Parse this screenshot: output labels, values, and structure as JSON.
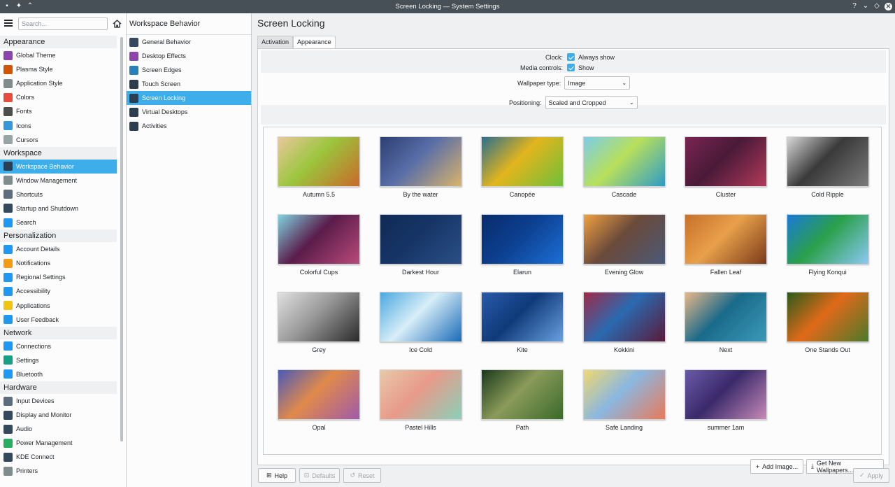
{
  "window": {
    "title": "Screen Locking — System Settings",
    "buttons": [
      "?",
      "⌄",
      "◇",
      "✕"
    ]
  },
  "sidebar": {
    "search_placeholder": "Search...",
    "groups": [
      {
        "title": "Appearance",
        "items": [
          {
            "label": "Global Theme",
            "icon": "global-theme-icon",
            "color": "#8e44ad"
          },
          {
            "label": "Plasma Style",
            "icon": "plasma-style-icon",
            "color": "#d35400"
          },
          {
            "label": "Application Style",
            "icon": "brush-icon",
            "color": "#7f8c8d"
          },
          {
            "label": "Colors",
            "icon": "colors-icon",
            "color": "#e74c3c"
          },
          {
            "label": "Fonts",
            "icon": "fonts-icon",
            "color": "#4d4d4d"
          },
          {
            "label": "Icons",
            "icon": "icons-icon",
            "color": "#3498db"
          },
          {
            "label": "Cursors",
            "icon": "cursor-icon",
            "color": "#95a5a6"
          }
        ]
      },
      {
        "title": "Workspace",
        "items": [
          {
            "label": "Workspace Behavior",
            "icon": "workspace-icon",
            "color": "#2c3e50",
            "selected": true
          },
          {
            "label": "Window Management",
            "icon": "window-icon",
            "color": "#7f8c8d"
          },
          {
            "label": "Shortcuts",
            "icon": "keyboard-icon",
            "color": "#5d6d7e"
          },
          {
            "label": "Startup and Shutdown",
            "icon": "startup-icon",
            "color": "#34495e"
          },
          {
            "label": "Search",
            "icon": "search-icon",
            "color": "#1d99f3"
          }
        ]
      },
      {
        "title": "Personalization",
        "items": [
          {
            "label": "Account Details",
            "icon": "account-icon",
            "color": "#1d99f3"
          },
          {
            "label": "Notifications",
            "icon": "bell-icon",
            "color": "#f39c12"
          },
          {
            "label": "Regional Settings",
            "icon": "flag-icon",
            "color": "#1d99f3"
          },
          {
            "label": "Accessibility",
            "icon": "accessibility-icon",
            "color": "#1d99f3"
          },
          {
            "label": "Applications",
            "icon": "star-icon",
            "color": "#f1c40f"
          },
          {
            "label": "User Feedback",
            "icon": "feedback-icon",
            "color": "#1d99f3"
          }
        ]
      },
      {
        "title": "Network",
        "items": [
          {
            "label": "Connections",
            "icon": "connections-icon",
            "color": "#1d99f3"
          },
          {
            "label": "Settings",
            "icon": "globe-icon",
            "color": "#16a085"
          },
          {
            "label": "Bluetooth",
            "icon": "bluetooth-icon",
            "color": "#1d99f3"
          }
        ]
      },
      {
        "title": "Hardware",
        "items": [
          {
            "label": "Input Devices",
            "icon": "keyboard-icon",
            "color": "#5d6d7e"
          },
          {
            "label": "Display and Monitor",
            "icon": "monitor-icon",
            "color": "#34495e"
          },
          {
            "label": "Audio",
            "icon": "audio-icon",
            "color": "#34495e"
          },
          {
            "label": "Power Management",
            "icon": "power-icon",
            "color": "#27ae60"
          },
          {
            "label": "KDE Connect",
            "icon": "phone-icon",
            "color": "#34495e"
          },
          {
            "label": "Printers",
            "icon": "printer-icon",
            "color": "#7f8c8d"
          }
        ]
      }
    ]
  },
  "subpanel": {
    "title": "Workspace Behavior",
    "items": [
      {
        "label": "General Behavior",
        "icon": "general-behavior-icon",
        "color": "#34495e"
      },
      {
        "label": "Desktop Effects",
        "icon": "desktop-effects-icon",
        "color": "#8e44ad"
      },
      {
        "label": "Screen Edges",
        "icon": "screen-edges-icon",
        "color": "#2980b9"
      },
      {
        "label": "Touch Screen",
        "icon": "touch-screen-icon",
        "color": "#2c3e50"
      },
      {
        "label": "Screen Locking",
        "icon": "lock-icon",
        "color": "#2c3e50",
        "selected": true
      },
      {
        "label": "Virtual Desktops",
        "icon": "virtual-desktops-icon",
        "color": "#2c3e50"
      },
      {
        "label": "Activities",
        "icon": "activities-icon",
        "color": "#2c3e50"
      }
    ]
  },
  "main": {
    "title": "Screen Locking",
    "tabs": [
      "Activation",
      "Appearance"
    ],
    "active_tab": 1,
    "clock_label": "Clock:",
    "clock_value": "Always show",
    "media_label": "Media controls:",
    "media_value": "Show",
    "wallpaper_type_label": "Wallpaper type:",
    "wallpaper_type_value": "Image",
    "positioning_label": "Positioning:",
    "positioning_value": "Scaled and Cropped",
    "wallpapers": [
      {
        "name": "Autumn 5.5",
        "colors": [
          "#e9c89b",
          "#c86a2a",
          "#9bc53d"
        ]
      },
      {
        "name": "By the water",
        "colors": [
          "#2b3f72",
          "#d9b46a",
          "#5a6ea8"
        ]
      },
      {
        "name": "Canopée",
        "colors": [
          "#2a6f8f",
          "#6fbf3a",
          "#e2b51c"
        ]
      },
      {
        "name": "Cascade",
        "colors": [
          "#7ccde8",
          "#2f9bc6",
          "#b8e05a"
        ]
      },
      {
        "name": "Cluster",
        "colors": [
          "#7a2452",
          "#b23a5a",
          "#4a1a38"
        ]
      },
      {
        "name": "Cold Ripple",
        "colors": [
          "#d7d7d7",
          "#7b7b7b",
          "#3a3a3a"
        ]
      },
      {
        "name": "Colorful Cups",
        "colors": [
          "#7fd3e0",
          "#b94a7a",
          "#5a1c4a"
        ]
      },
      {
        "name": "Darkest Hour",
        "colors": [
          "#0f2a55",
          "#2a4f86",
          "#163566"
        ]
      },
      {
        "name": "Elarun",
        "colors": [
          "#082c6c",
          "#1d6fd6",
          "#0c3f8f"
        ]
      },
      {
        "name": "Evening Glow",
        "colors": [
          "#f0a040",
          "#4a5a78",
          "#6b4a3a"
        ]
      },
      {
        "name": "Fallen Leaf",
        "colors": [
          "#c8702a",
          "#7a3a1a",
          "#e8a04a"
        ]
      },
      {
        "name": "Flying Konqui",
        "colors": [
          "#1a7ad8",
          "#8cc8f5",
          "#2aa04a"
        ]
      },
      {
        "name": "Grey",
        "colors": [
          "#e0e0e0",
          "#2a2a2a",
          "#9a9a9a"
        ]
      },
      {
        "name": "Ice Cold",
        "colors": [
          "#4aa8e0",
          "#1a6ab8",
          "#d8eef8"
        ]
      },
      {
        "name": "Kite",
        "colors": [
          "#2a5aa8",
          "#6aa0e0",
          "#0f3a7a"
        ]
      },
      {
        "name": "Kokkini",
        "colors": [
          "#a02a48",
          "#5a1a3a",
          "#2a6ab0"
        ]
      },
      {
        "name": "Next",
        "colors": [
          "#e8b888",
          "#3a9ab8",
          "#1a6a8a"
        ]
      },
      {
        "name": "One Stands Out",
        "colors": [
          "#2a5a1a",
          "#4a7a2a",
          "#e06a1a"
        ]
      },
      {
        "name": "Opal",
        "colors": [
          "#4a5ab8",
          "#a05aa8",
          "#e08a4a"
        ]
      },
      {
        "name": "Pastel Hills",
        "colors": [
          "#e8c8a8",
          "#8ad0b8",
          "#e89a8a"
        ]
      },
      {
        "name": "Path",
        "colors": [
          "#1a3a1a",
          "#3a6a2a",
          "#8a9a5a"
        ]
      },
      {
        "name": "Safe Landing",
        "colors": [
          "#f0d870",
          "#e87a5a",
          "#8ab8e0"
        ]
      },
      {
        "name": "summer 1am",
        "colors": [
          "#6a5aa8",
          "#c88ab8",
          "#3a2a6a"
        ]
      }
    ],
    "add_image_label": "Add Image...",
    "get_new_label": "Get New Wallpapers..."
  },
  "footer": {
    "help_label": "Help",
    "defaults_label": "Defaults",
    "reset_label": "Reset",
    "apply_label": "Apply"
  }
}
